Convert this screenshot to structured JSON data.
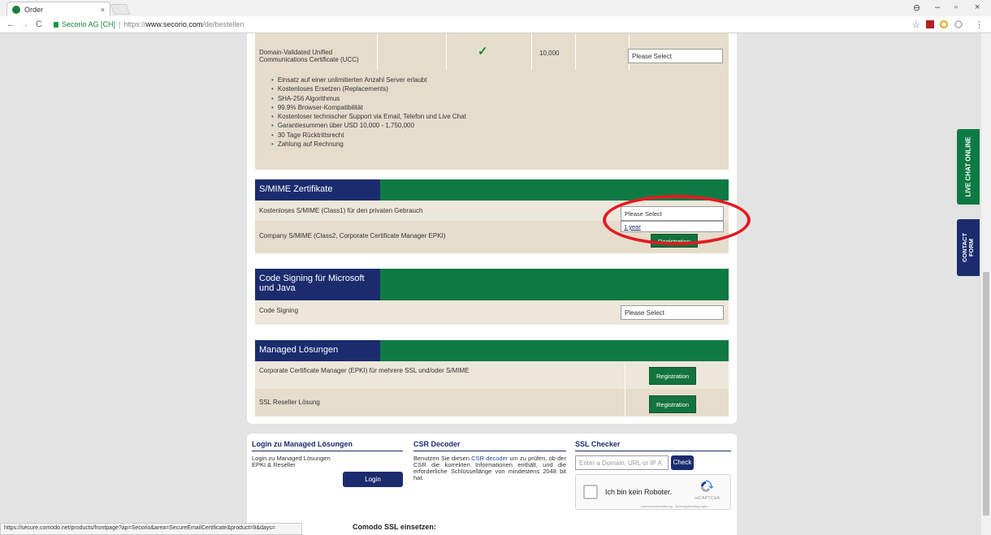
{
  "browser": {
    "tab_title": "Order",
    "tab_close": "×",
    "url_secure": "Secorio AG [CH]",
    "url_sep": "|",
    "url_scheme": "https://",
    "url_host": "www.secorio.com",
    "url_path": "/de/bestellen",
    "back": "←",
    "forward": "→",
    "reload": "C",
    "user_icon": "⊖",
    "minimize": "–",
    "maximize": "▫",
    "close": "×",
    "star": "☆",
    "menu": "⋮"
  },
  "ucc": {
    "title_line1": "Domain-Validated Unified",
    "title_line2": "Communications Certificate (UCC)",
    "check": "✓",
    "value": "10,000",
    "select": "Please Select",
    "features": [
      "Einsatz auf einer unlimitierten Anzahl Server erlaubt",
      "Kostenloses Ersetzen (Replacements)",
      "SHA-256 Algorithmus",
      "99.9% Browser-Kompatibilität",
      "Kostenloser technischer Support via Email, Telefon und Live Chat",
      "Garantiesummen über USD 10,000 - 1,750,000",
      "30 Tage Rücktrittsrecht",
      "Zahlung auf Rechnung"
    ]
  },
  "smime": {
    "header": "S/MIME Zertifikate",
    "row1": "Kostenloses S/MIME (Class1) für den privaten Gebrauch",
    "row1_select": "Please Select",
    "row1_option": "1 year",
    "row2": "Company S/MIME (Class2, Corporate Certificate Manager EPKI)",
    "row2_button": "Registration"
  },
  "codesign": {
    "header_line1": "Code Signing für Microsoft",
    "header_line2": "und Java",
    "row1": "Code Signing",
    "row1_select": "Please Select"
  },
  "managed": {
    "header": "Managed Lösungen",
    "row1": "Corporate Certificate Manager (EPKI) für mehrere SSL und/oder S/MIME",
    "row1_button": "Registration",
    "row2": "SSL Reseller Lösung",
    "row2_button": "Registration"
  },
  "bottom": {
    "login_title": "Login zu Managed Lösungen",
    "login_line1": "Login zu Managed Lösungen",
    "login_line2": "EPKI & Reseller",
    "login_button": "Login",
    "csr_title": "CSR Decoder",
    "csr_pre": "Benutzen Sie diesen",
    "csr_link": "CSR decoder",
    "csr_rest": "um zu prüfen, ob der CSR die korrekten Informationen enthält, und die erforderliche Schlüssellänge von mindestens 2048 bit hat.",
    "ssl_title": "SSL Checker",
    "ssl_placeholder": "Enter a Domain, URL or IP A",
    "ssl_button": "Check",
    "captcha_label": "Ich bin kein Roboter.",
    "captcha_brand": "reCAPTCHA",
    "captcha_terms": "Datenschutzerklärung - Nutzungsbedingungen",
    "next_heading": "Comodo SSL einsetzen:"
  },
  "side": {
    "chat": "LIVE CHAT ONLINE",
    "contact_line1": "CONTACT",
    "contact_line2": "FORM"
  },
  "status_url": "https://secure.comodo.net/products/frontpage?ap=Secorio&area=SecureEmailCertificate&product=9&days=",
  "colors": {
    "green": "#0e7a43",
    "navy": "#1b2c6e",
    "beige": "#ede6da",
    "highlight_red": "#e21b22"
  }
}
